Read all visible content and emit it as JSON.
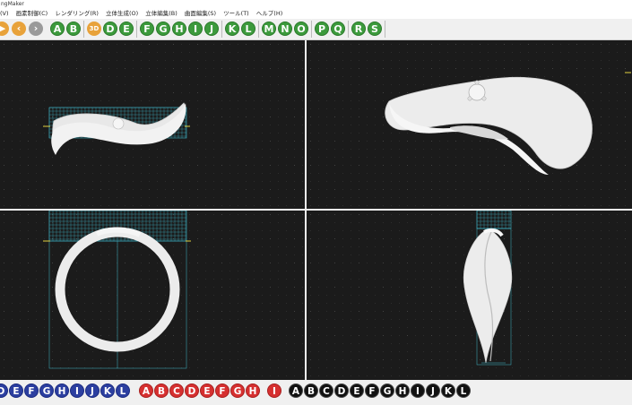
{
  "window": {
    "title": "ngMaker"
  },
  "menu": {
    "items": [
      "(V)",
      "画素制御(C)",
      "レンダリング(R)",
      "立体生成(O)",
      "立体編集(B)",
      "曲面編集(S)",
      "ツール(T)",
      "ヘルプ(H)"
    ]
  },
  "toolbar": {
    "nav_buttons": [
      {
        "label": "",
        "color": "orange",
        "icon": "arrow-right-icon"
      },
      {
        "label": "",
        "color": "orange",
        "icon": "chevron-left-icon"
      },
      {
        "label": "",
        "color": "grey",
        "icon": "chevron-right-icon"
      }
    ],
    "group1": [
      "A",
      "B"
    ],
    "view3d": "3D",
    "group2": [
      "D",
      "E"
    ],
    "group3": [
      "F",
      "G",
      "H",
      "I",
      "J"
    ],
    "group4": [
      "K",
      "L"
    ],
    "group5": [
      "M",
      "N",
      "O"
    ],
    "group6": [
      "P",
      "Q"
    ],
    "group7": [
      "R",
      "S"
    ]
  },
  "bottom_toolbar": {
    "blue_group": [
      "D",
      "E",
      "F",
      "G",
      "H",
      "I",
      "J",
      "K",
      "L"
    ],
    "red_group": [
      "A",
      "B",
      "C",
      "D",
      "E",
      "F",
      "G",
      "H"
    ],
    "red_single": "I",
    "black_group": [
      "A",
      "B",
      "C",
      "D",
      "E",
      "F",
      "G",
      "H",
      "I",
      "J",
      "K",
      "L"
    ]
  },
  "colors": {
    "viewport_bg": "#1b1b1b",
    "grid_dot": "#4a4a4a",
    "cyan_grid": "#3fb6c8",
    "ring": "#e8e8e8",
    "yellow_mark": "#e0d040",
    "green_button": "#3c9a3c",
    "blue_button": "#2c3fa0",
    "red_button": "#d63030",
    "black_button": "#111111"
  }
}
